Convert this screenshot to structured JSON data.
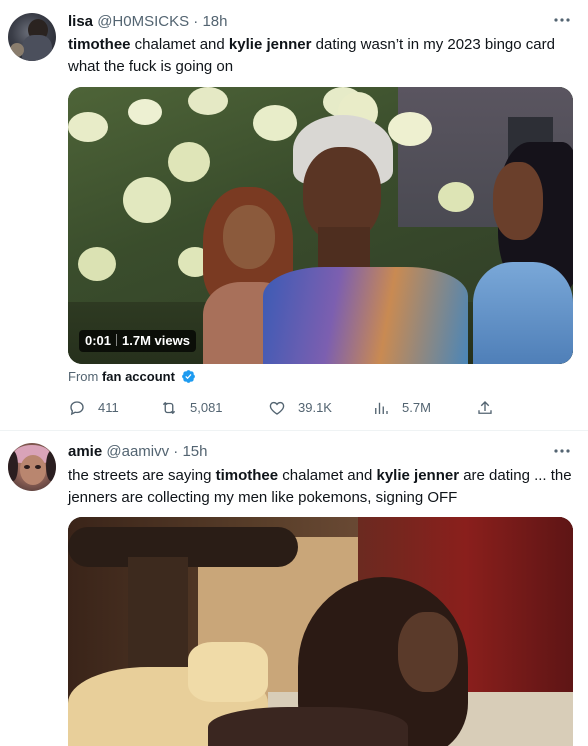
{
  "tweets": [
    {
      "name": "lisa",
      "handle": "@H0MSICKS",
      "dot": "·",
      "time": "18h",
      "more_icon": "more-horizontal-icon",
      "text_parts": [
        "timothee",
        " chalamet and ",
        "kylie jenner",
        " dating wasn’t in my 2023 bingo card what the fuck is going on"
      ],
      "video": {
        "timestamp": "0:01",
        "views": "1.7M views"
      },
      "from_label": "From",
      "from_account": "fan account",
      "verified_icon": "verified-badge-icon",
      "actions": {
        "replies": "411",
        "retweets": "5,081",
        "likes": "39.1K",
        "views": "5.7M"
      }
    },
    {
      "name": "amie",
      "handle": "@aamivv",
      "dot": "·",
      "time": "15h",
      "more_icon": "more-horizontal-icon",
      "text_parts": [
        "the streets are saying ",
        "timothee",
        " chalamet and ",
        "kylie jenner",
        " are dating ... the jenners are collecting my men like pokemons, signing OFF"
      ]
    }
  ],
  "colors": {
    "text_primary": "#0f1419",
    "text_secondary": "#536471",
    "verified_blue": "#1d9bf0",
    "divider": "#eff3f4"
  }
}
